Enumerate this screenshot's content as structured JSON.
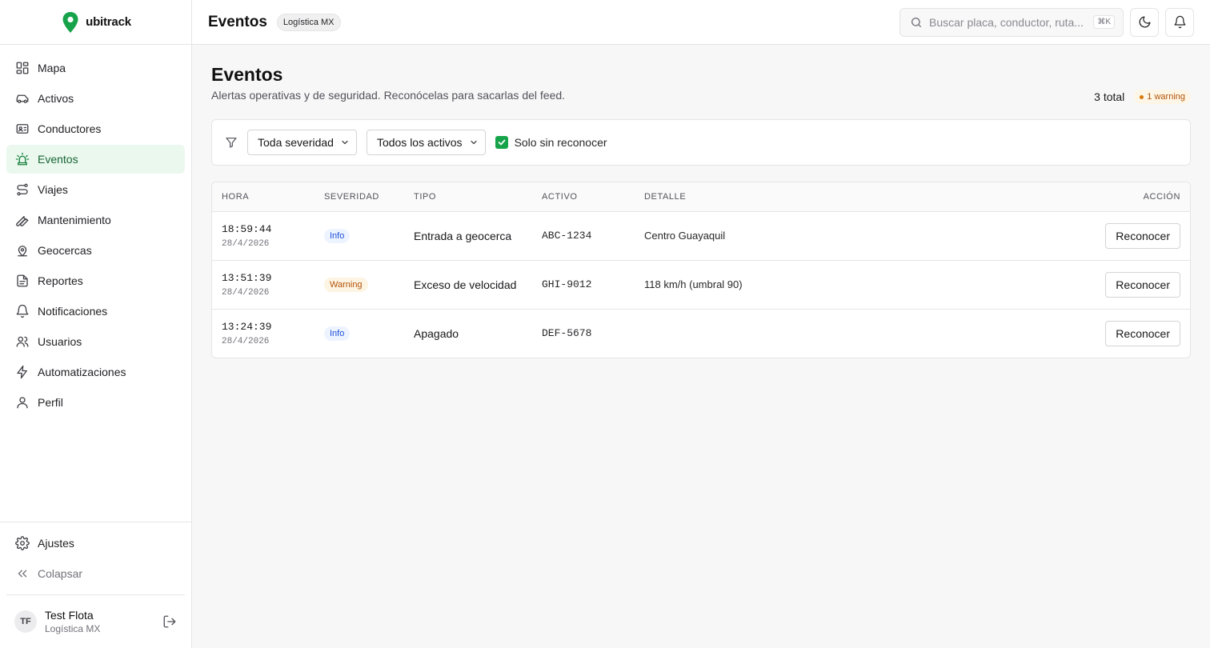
{
  "brand": {
    "name": "ubitrack"
  },
  "sidebar": {
    "items": [
      {
        "label": "Mapa",
        "icon": "map-grid-icon"
      },
      {
        "label": "Activos",
        "icon": "car-icon"
      },
      {
        "label": "Conductores",
        "icon": "id-card-icon"
      },
      {
        "label": "Eventos",
        "icon": "siren-icon",
        "active": true
      },
      {
        "label": "Viajes",
        "icon": "route-icon"
      },
      {
        "label": "Mantenimiento",
        "icon": "wrench-icon"
      },
      {
        "label": "Geocercas",
        "icon": "map-pin-icon"
      },
      {
        "label": "Reportes",
        "icon": "file-report-icon"
      },
      {
        "label": "Notificaciones",
        "icon": "bell-icon"
      },
      {
        "label": "Usuarios",
        "icon": "users-icon"
      },
      {
        "label": "Automatizaciones",
        "icon": "zap-icon"
      },
      {
        "label": "Perfil",
        "icon": "user-icon"
      }
    ],
    "settings_label": "Ajustes",
    "collapse_label": "Colapsar",
    "user": {
      "initials": "TF",
      "name": "Test Flota",
      "org": "Logística MX"
    }
  },
  "header": {
    "title": "Eventos",
    "org_badge": "Logística MX",
    "search_placeholder": "Buscar placa, conductor, ruta...",
    "shortcut": "⌘K"
  },
  "page": {
    "title": "Eventos",
    "subtitle": "Alertas operativas y de seguridad. Reconócelas para sacarlas del feed.",
    "total": "3 total",
    "warning_badge": "1 warning"
  },
  "filters": {
    "severity": "Toda severidad",
    "assets": "Todos los activos",
    "unacked_label": "Solo sin reconocer",
    "unacked_checked": true
  },
  "table": {
    "columns": [
      "HORA",
      "SEVERIDAD",
      "TIPO",
      "ACTIVO",
      "DETALLE",
      "ACCIÓN"
    ],
    "action_label": "Reconocer",
    "rows": [
      {
        "time": "18:59:44",
        "date": "28/4/2026",
        "severity": "Info",
        "type": "Entrada a geocerca",
        "asset": "ABC-1234",
        "detail": "Centro Guayaquil"
      },
      {
        "time": "13:51:39",
        "date": "28/4/2026",
        "severity": "Warning",
        "type": "Exceso de velocidad",
        "asset": "GHI-9012",
        "detail": "118 km/h (umbral 90)"
      },
      {
        "time": "13:24:39",
        "date": "28/4/2026",
        "severity": "Info",
        "type": "Apagado",
        "asset": "DEF-5678",
        "detail": ""
      }
    ]
  },
  "colors": {
    "accent": "#16a34a",
    "active_bg": "#ebf8ee",
    "info": "#1d4ed8",
    "warning": "#b45309"
  }
}
